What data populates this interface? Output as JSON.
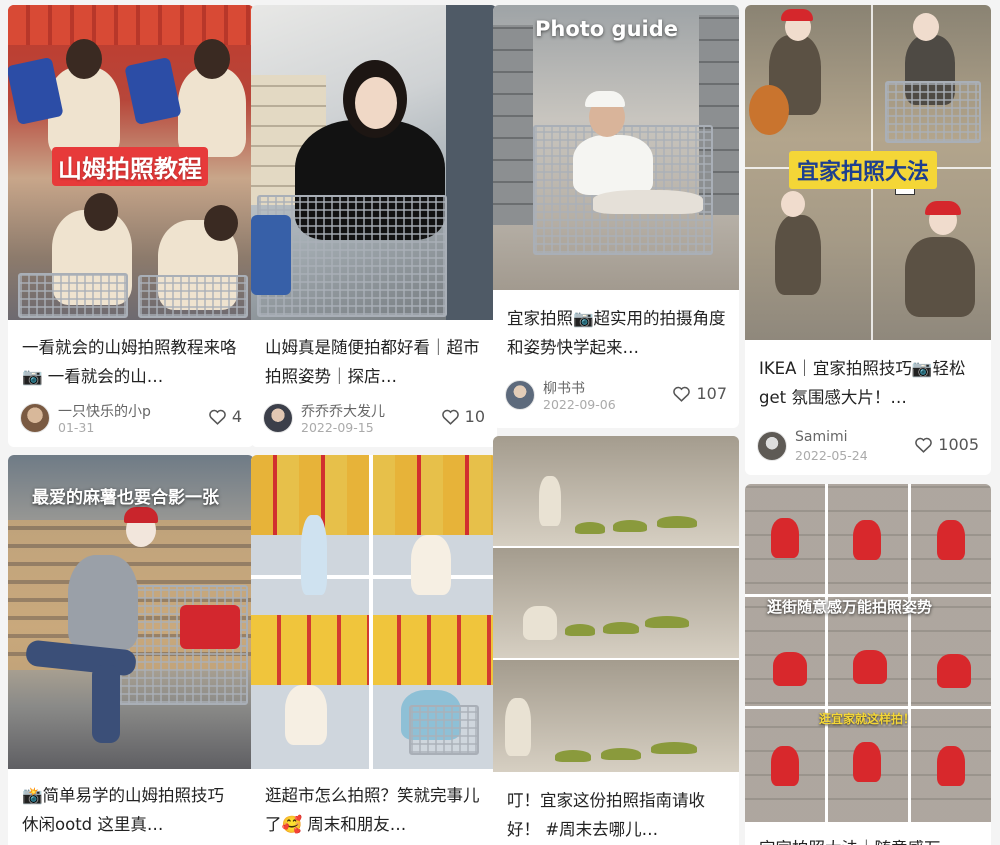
{
  "cards": [
    {
      "overlay": "山姆拍照教程",
      "title": "一看就会的山姆拍照教程来咯📷 一看就会的山…",
      "author": "一只快乐的小p",
      "date": "01-31",
      "likes": "4"
    },
    {
      "overlay": "",
      "title": "山姆真是随便拍都好看｜超市拍照姿势｜探店…",
      "author": "乔乔乔大发儿",
      "date": "2022-09-15",
      "likes": "10"
    },
    {
      "overlay": "Photo guide",
      "title": "宜家拍照📷超实用的拍摄角度和姿势快学起来…",
      "author": "柳书书",
      "date": "2022-09-06",
      "likes": "107"
    },
    {
      "overlay": "宜家拍照大法",
      "title": "IKEA｜宜家拍照技巧📷轻松 get 氛围感大片！…",
      "author": "Samimi",
      "date": "2022-05-24",
      "likes": "1005"
    },
    {
      "overlay": "最爱的麻薯也要合影一张",
      "title": "📸简单易学的山姆拍照技巧 休闲ootd 这里真…",
      "author": "",
      "date": "",
      "likes": ""
    },
    {
      "overlay": "",
      "title": "逛超市怎么拍照？笑就完事儿了🥰 周末和朋友…",
      "author": "",
      "date": "",
      "likes": ""
    },
    {
      "overlay": "",
      "title": "叮！宜家这份拍照指南请收好！ #周末去哪儿…",
      "author": "",
      "date": "",
      "likes": ""
    },
    {
      "overlay": "逛街随意感万能拍照姿势",
      "overlay2": "逛宜家就这样拍！",
      "title": "宜家拍照大法｜随意感万…",
      "author": "",
      "date": "",
      "likes": ""
    }
  ],
  "icons": {
    "like": "heart-outline-icon"
  },
  "colors": {
    "overlay_red": "#e7303f",
    "overlay_yellow": "#f4d637",
    "text": "#222222",
    "meta": "#999999"
  }
}
